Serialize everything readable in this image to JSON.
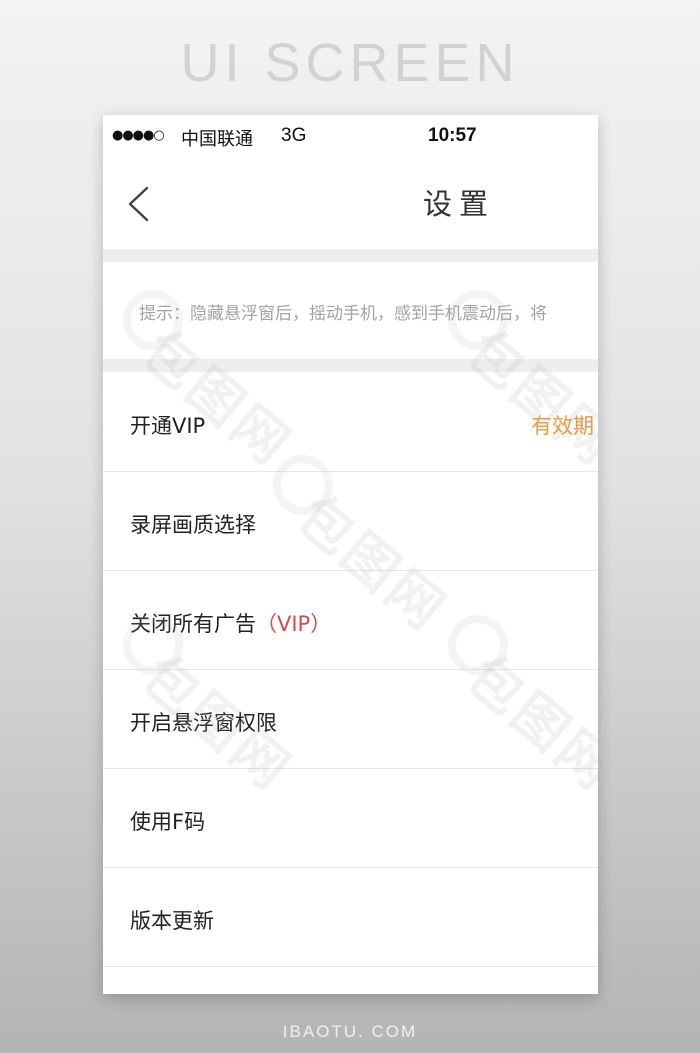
{
  "poster": {
    "title": "UI SCREEN",
    "footer": "IBAOTU. COM",
    "watermark_text": "包图网"
  },
  "status_bar": {
    "signal": "●●●●○",
    "carrier": "中国联通",
    "network": "3G",
    "time": "10:57"
  },
  "nav": {
    "back_icon": "chevron-left-icon",
    "title": "设置"
  },
  "tip": {
    "text": "提示：隐藏悬浮窗后，摇动手机，感到手机震动后，将"
  },
  "menu": {
    "items": [
      {
        "label": "开通VIP",
        "value": "有效期"
      },
      {
        "label": "录屏画质选择"
      },
      {
        "label": "关闭所有广告",
        "tag": "（VIP）"
      },
      {
        "label": "开启悬浮窗权限"
      },
      {
        "label": "使用F码"
      },
      {
        "label": "版本更新"
      }
    ]
  },
  "colors": {
    "accent_orange": "#ee9a3a",
    "vip_red": "#d8494d",
    "section_gap": "#eeeeee"
  }
}
